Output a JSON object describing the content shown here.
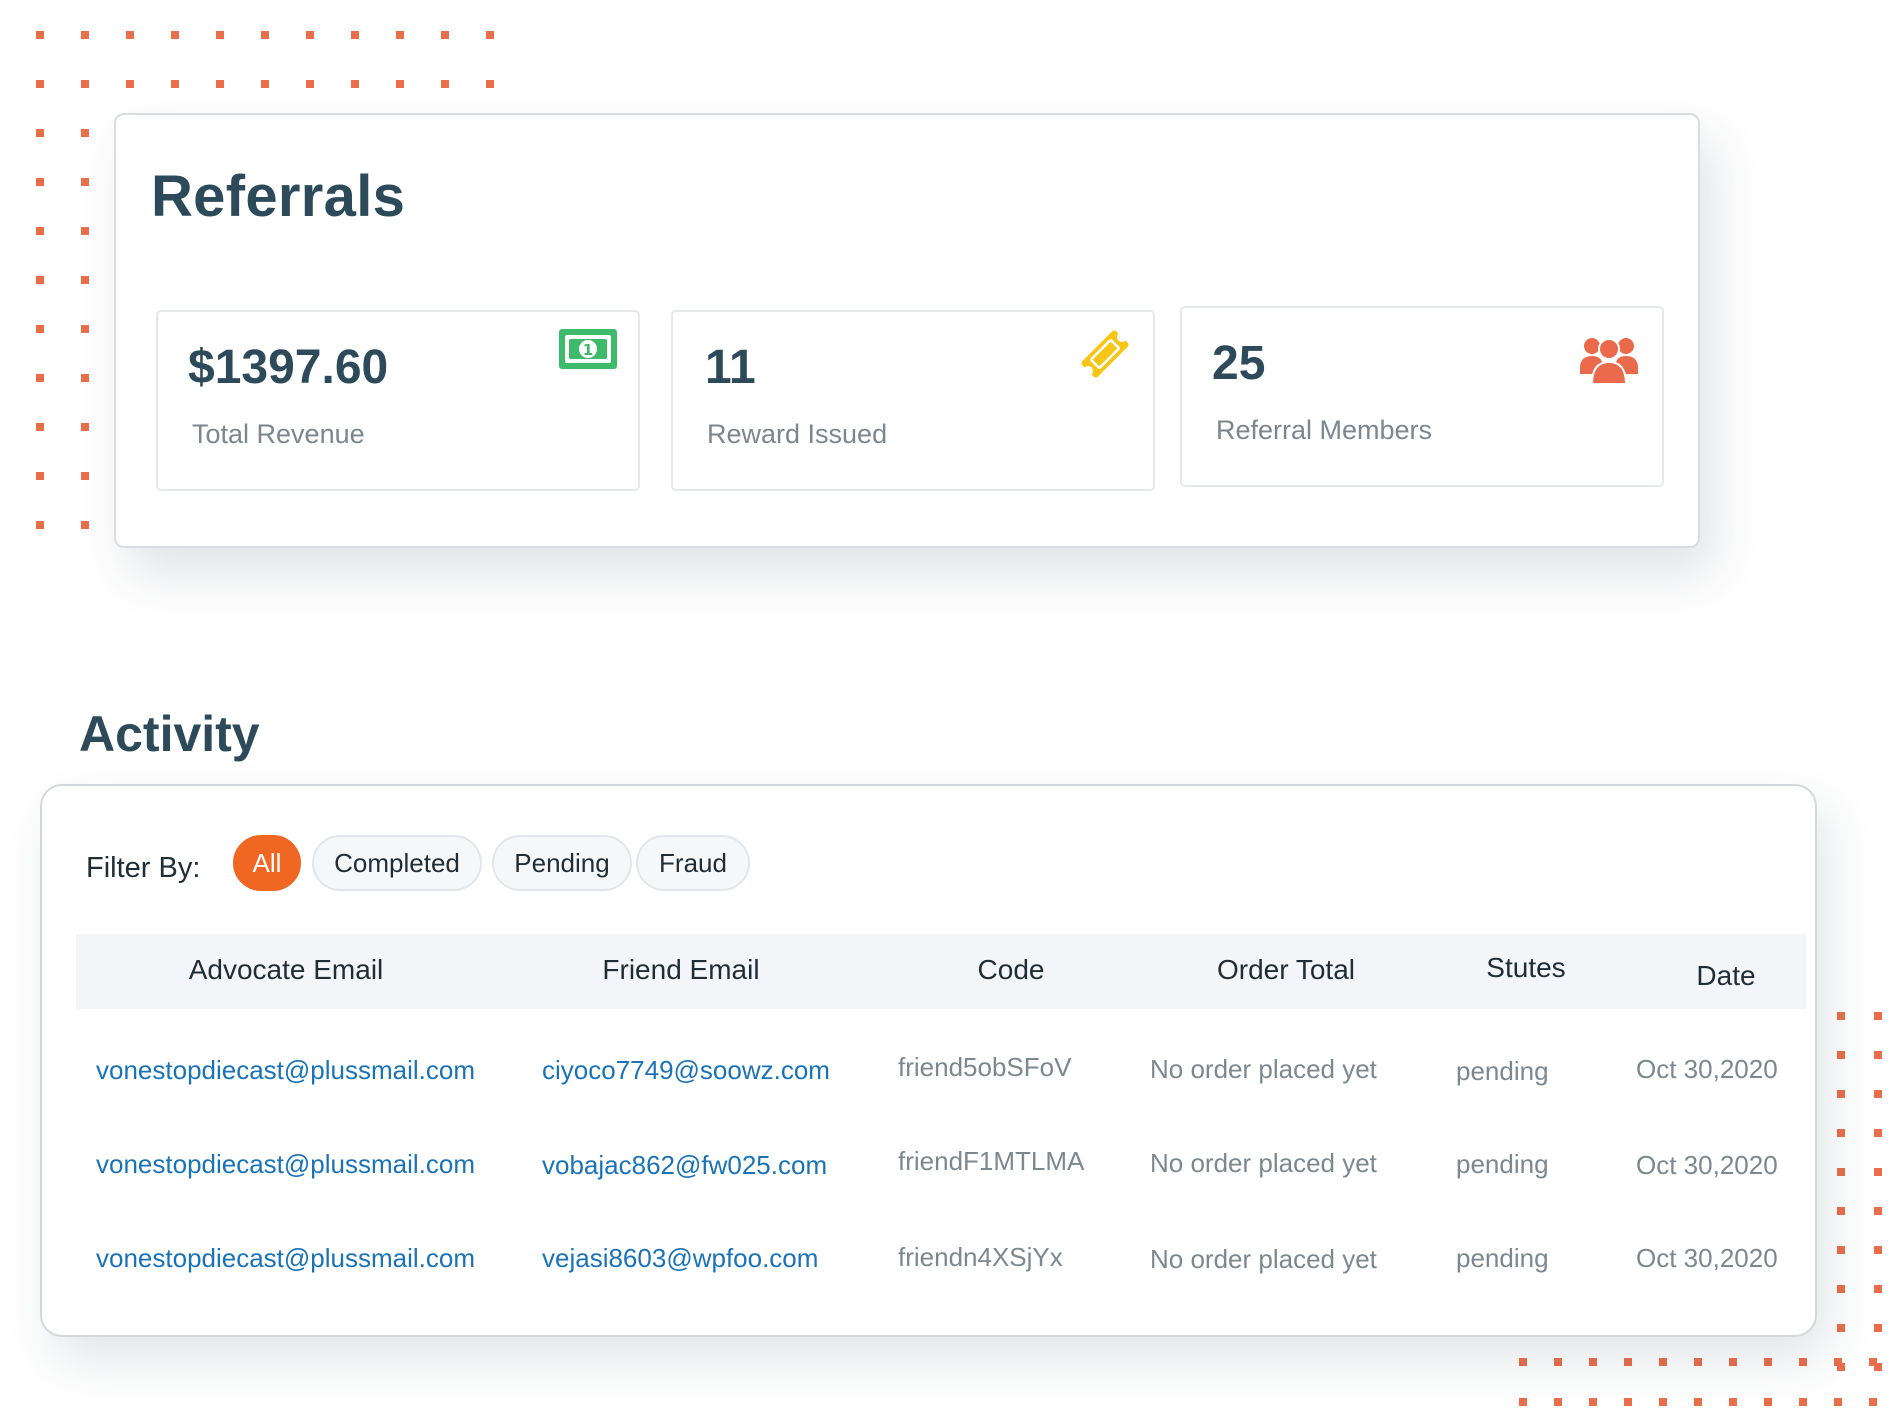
{
  "colors": {
    "accent": "#f06723",
    "heading": "#2c4a5a",
    "link": "#1a73b8",
    "muted": "#7c8890",
    "decor_dots": "#ea6e4a"
  },
  "referrals": {
    "title": "Referrals",
    "stats": [
      {
        "value": "$1397.60",
        "label": "Total Revenue",
        "icon": "money-bill-icon",
        "icon_color": "#3dbb6b"
      },
      {
        "value": "11",
        "label": "Reward Issued",
        "icon": "ticket-icon",
        "icon_color": "#f7c515"
      },
      {
        "value": "25",
        "label": "Referral Members",
        "icon": "users-icon",
        "icon_color": "#ec6a4c"
      }
    ]
  },
  "activity": {
    "title": "Activity",
    "filter_label": "Filter By:",
    "filters": [
      "All",
      "Completed",
      "Pending",
      "Fraud"
    ],
    "active_filter": "All",
    "columns": [
      "Advocate Email",
      "Friend Email",
      "Code",
      "Order Total",
      "Stutes",
      "Date"
    ],
    "rows": [
      [
        "vonestopdiecast@plussmail.com",
        "ciyoco7749@soowz.com",
        "friend5obSFoV",
        "No order placed yet",
        "pending",
        "Oct 30,2020"
      ],
      [
        "vonestopdiecast@plussmail.com",
        "vobajac862@fw025.com",
        "friendF1MTLMA",
        "No order placed yet",
        "pending",
        "Oct 30,2020"
      ],
      [
        "vonestopdiecast@plussmail.com",
        "vejasi8603@wpfoo.com",
        "friendn4XSjYx",
        "No order placed yet",
        "pending",
        "Oct 30,2020"
      ]
    ]
  }
}
